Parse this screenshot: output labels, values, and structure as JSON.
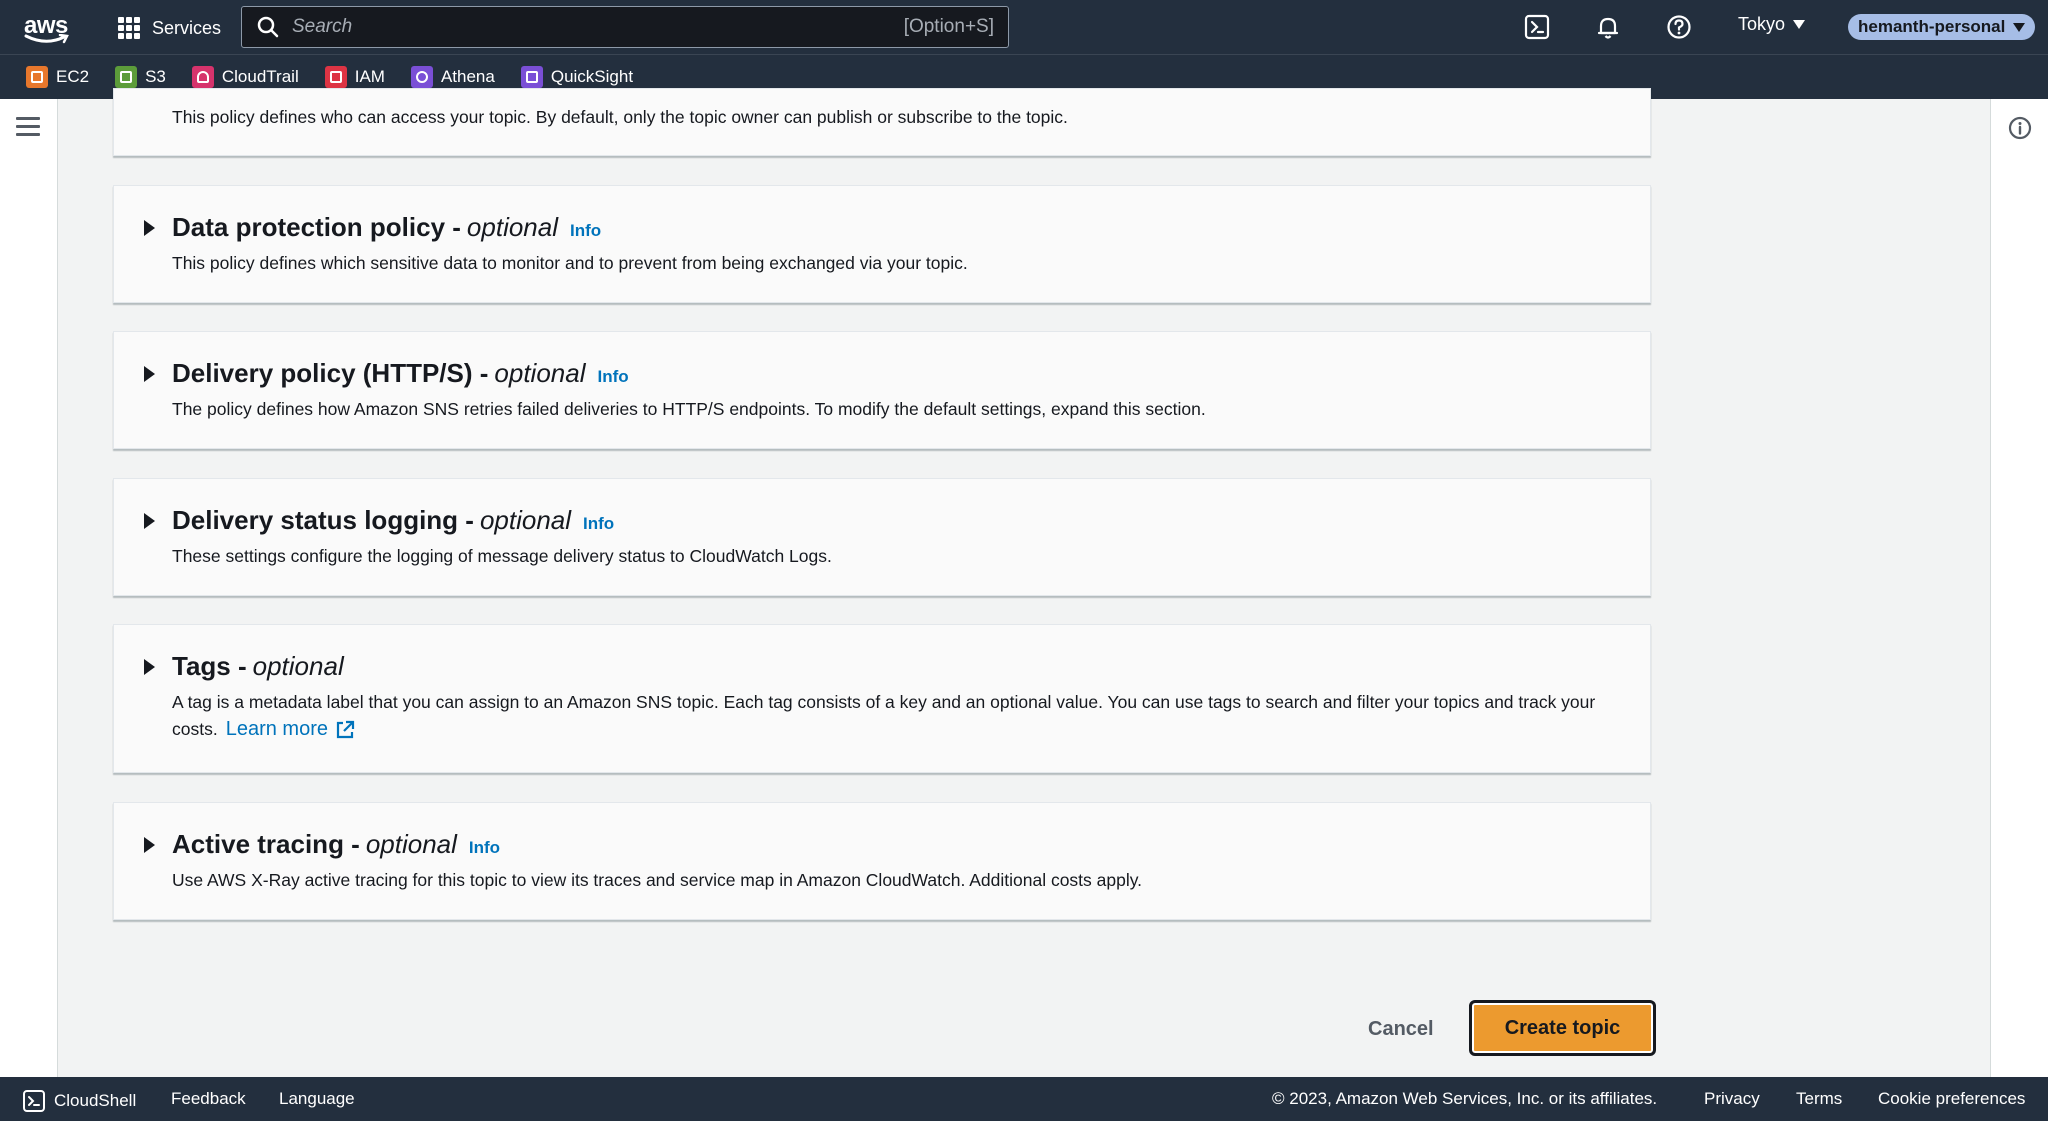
{
  "topbar": {
    "logo": "aws",
    "services_label": "Services",
    "search_placeholder": "Search",
    "search_shortcut": "[Option+S]",
    "region": "Tokyo",
    "account": "hemanth-personal",
    "icons": [
      "cloudshell-icon",
      "bell-icon",
      "help-icon"
    ]
  },
  "favorites": [
    {
      "label": "EC2",
      "color": "#e7772c"
    },
    {
      "label": "S3",
      "color": "#5c9c3a"
    },
    {
      "label": "CloudTrail",
      "color": "#d6336c"
    },
    {
      "label": "IAM",
      "color": "#dd3444"
    },
    {
      "label": "Athena",
      "color": "#7a4fd6"
    },
    {
      "label": "QuickSight",
      "color": "#7a4fd6"
    }
  ],
  "panels": {
    "access": {
      "desc": "This policy defines who can access your topic. By default, only the topic owner can publish or subscribe to the topic."
    },
    "data_protection": {
      "title": "Data protection policy -",
      "optional": "optional",
      "info": "Info",
      "desc": "This policy defines which sensitive data to monitor and to prevent from being exchanged via your topic."
    },
    "delivery_policy": {
      "title": "Delivery policy (HTTP/S) -",
      "optional": "optional",
      "info": "Info",
      "desc": "The policy defines how Amazon SNS retries failed deliveries to HTTP/S endpoints. To modify the default settings, expand this section."
    },
    "delivery_logging": {
      "title": "Delivery status logging -",
      "optional": "optional",
      "info": "Info",
      "desc": "These settings configure the logging of message delivery status to CloudWatch Logs."
    },
    "tags": {
      "title": "Tags -",
      "optional": "optional",
      "desc_line1": "A tag is a metadata label that you can assign to an Amazon SNS topic. Each tag consists of a key and an optional value. You can use tags to search and filter your topics and track your",
      "desc_line2": "costs.",
      "learn_more": "Learn more"
    },
    "tracing": {
      "title": "Active tracing -",
      "optional": "optional",
      "info": "Info",
      "desc": "Use AWS X-Ray active tracing for this topic to view its traces and service map in Amazon CloudWatch. Additional costs apply."
    }
  },
  "actions": {
    "cancel": "Cancel",
    "create": "Create topic"
  },
  "footer": {
    "cloudshell": "CloudShell",
    "feedback": "Feedback",
    "language": "Language",
    "copyright": "© 2023, Amazon Web Services, Inc. or its affiliates.",
    "privacy": "Privacy",
    "terms": "Terms",
    "cookies": "Cookie preferences"
  }
}
